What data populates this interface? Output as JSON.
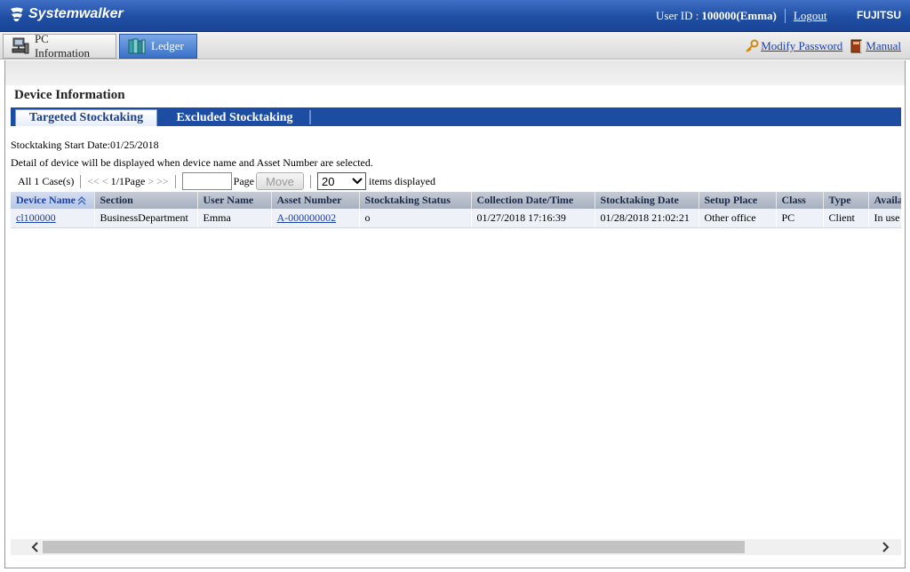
{
  "header": {
    "brand": "Systemwalker",
    "user_label": "User ID :",
    "user_value": "100000(Emma)",
    "logout": "Logout",
    "vendor": "FUJITSU"
  },
  "nav": {
    "tabs": [
      {
        "label": "PC Information",
        "icon": "pc-icon"
      },
      {
        "label": "Ledger",
        "icon": "ledger-icon"
      }
    ],
    "modify_password": "Modify Password",
    "manual": "Manual"
  },
  "page": {
    "title": "Device Information",
    "tabs": [
      "Targeted Stocktaking",
      "Excluded Stocktaking"
    ],
    "start_date": "Stocktaking Start Date:01/25/2018",
    "hint": "Detail of device will be displayed when device name and Asset Number are selected."
  },
  "pager": {
    "total": "All 1 Case(s)",
    "first": "<<",
    "prev": "<",
    "current": "1/1Page",
    "next": ">",
    "last": ">>",
    "page_input_value": "",
    "page_label": "Page",
    "move": "Move",
    "per_page": "20",
    "per_page_label": "items displayed"
  },
  "table": {
    "columns": [
      "Device Name",
      "Section",
      "User Name",
      "Asset Number",
      "Stocktaking Status",
      "Collection Date/Time",
      "Stocktaking Date",
      "Setup Place",
      "Class",
      "Type",
      "Availability"
    ],
    "rows": [
      [
        "cl100000",
        "BusinessDepartment",
        "Emma",
        "A-000000002",
        "o",
        "01/27/2018 17:16:39",
        "01/28/2018 21:02:21",
        "Other office",
        "PC",
        "Client",
        "In use"
      ]
    ]
  },
  "colors": {
    "header_blue": "#1f4ea3",
    "tab_blue": "#1d4da2",
    "link_blue": "#1b3fa8"
  }
}
